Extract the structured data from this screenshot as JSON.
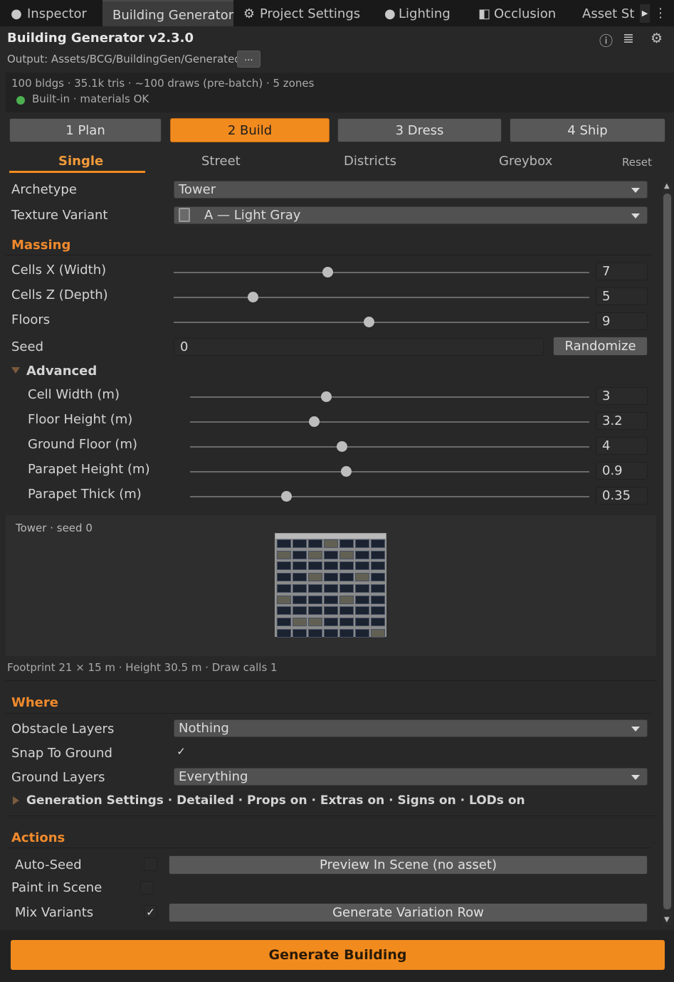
{
  "tabs": [
    {
      "label": "Inspector",
      "icon": "info-circle-icon",
      "active": false
    },
    {
      "label": "Building Generator",
      "icon": "",
      "active": true
    },
    {
      "label": "Project Settings",
      "icon": "gear-icon",
      "active": false
    },
    {
      "label": "Lighting",
      "icon": "lightbulb-icon",
      "active": false
    },
    {
      "label": "Occlusion",
      "icon": "occlusion-icon",
      "active": false
    },
    {
      "label": "Asset St",
      "icon": "",
      "active": false
    }
  ],
  "header": {
    "title": "Building Generator v2.3.0",
    "output": "Output: Assets/BCG/BuildingGen/Generated",
    "browse_label": "...",
    "stats_line": "100 bldgs · 35.1k tris · ~100 draws (pre-batch) · 5 zones",
    "status_line": "Built-in · materials OK"
  },
  "steps": [
    "1 Plan",
    "2 Build",
    "3 Dress",
    "4 Ship"
  ],
  "subtabs": {
    "items": [
      "Single",
      "Street",
      "Districts",
      "Greybox"
    ],
    "reset": "Reset"
  },
  "archetype": {
    "label": "Archetype",
    "value": "Tower"
  },
  "texture": {
    "label": "Texture Variant",
    "value": "A — Light Gray"
  },
  "massing": {
    "title": "Massing",
    "sliders": [
      {
        "label": "Cells X (Width)",
        "value": "7",
        "fraction": 0.37
      },
      {
        "label": "Cells Z (Depth)",
        "value": "5",
        "fraction": 0.19
      },
      {
        "label": "Floors",
        "value": "9",
        "fraction": 0.47
      }
    ],
    "seed": {
      "label": "Seed",
      "value": "0",
      "button": "Randomize"
    },
    "advanced": {
      "label": "Advanced",
      "sliders": [
        {
          "label": "Cell Width (m)",
          "value": "3",
          "fraction": 0.34
        },
        {
          "label": "Floor Height (m)",
          "value": "3.2",
          "fraction": 0.31
        },
        {
          "label": "Ground Floor (m)",
          "value": "4",
          "fraction": 0.38
        },
        {
          "label": "Parapet Height (m)",
          "value": "0.9",
          "fraction": 0.39
        },
        {
          "label": "Parapet Thick (m)",
          "value": "0.35",
          "fraction": 0.24
        }
      ]
    }
  },
  "preview": {
    "label": "Tower · seed 0",
    "footer": "Footprint 21 × 15 m · Height 30.5 m · Draw calls 1"
  },
  "where": {
    "title": "Where",
    "obstacle": {
      "label": "Obstacle Layers",
      "value": "Nothing"
    },
    "snap": {
      "label": "Snap To Ground",
      "checked": true
    },
    "ground": {
      "label": "Ground Layers",
      "value": "Everything"
    },
    "generation": "Generation Settings · Detailed · Props on · Extras on · Signs on · LODs on"
  },
  "actions": {
    "title": "Actions",
    "auto_seed": {
      "label": "Auto-Seed",
      "checked": false
    },
    "preview_button": "Preview In Scene (no asset)",
    "paint": {
      "label": "Paint in Scene",
      "checked": false
    },
    "mix": {
      "label": "Mix Variants",
      "checked": true
    },
    "variation_button": "Generate Variation Row"
  },
  "generate_button": "Generate Building",
  "colors": {
    "accent": "#f28b1e",
    "ok": "#4caf50",
    "section": "#f08a2c"
  }
}
